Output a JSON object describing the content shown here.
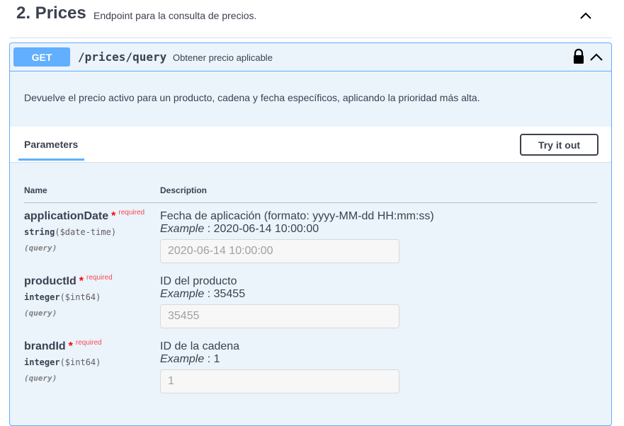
{
  "tag": {
    "title": "2. Prices",
    "description": "Endpoint para la consulta de precios."
  },
  "operation": {
    "method": "GET",
    "path": "/prices/query",
    "summary": "Obtener precio aplicable",
    "description": "Devuelve el precio activo para un producto, cadena y fecha específicos, aplicando la prioridad más alta.",
    "method_color": "#61affe"
  },
  "parameters_section": {
    "tab_label": "Parameters",
    "try_button": "Try it out",
    "col_name": "Name",
    "col_description": "Description"
  },
  "parameters": [
    {
      "name": "applicationDate",
      "required_mark": "*",
      "required_label": "required",
      "type": "string",
      "format": "($date-time)",
      "in": "(query)",
      "description": "Fecha de aplicación (formato: yyyy-MM-dd HH:mm:ss)",
      "example_label": "Example",
      "example_value": ": 2020-06-14 10:00:00",
      "placeholder": "2020-06-14 10:00:00"
    },
    {
      "name": "productId",
      "required_mark": "*",
      "required_label": "required",
      "type": "integer",
      "format": "($int64)",
      "in": "(query)",
      "description": "ID del producto",
      "example_label": "Example",
      "example_value": ": 35455",
      "placeholder": "35455"
    },
    {
      "name": "brandId",
      "required_mark": "*",
      "required_label": "required",
      "type": "integer",
      "format": "($int64)",
      "in": "(query)",
      "description": "ID de la cadena",
      "example_label": "Example",
      "example_value": ": 1",
      "placeholder": "1"
    }
  ],
  "icons": {
    "tag_toggle": "chevron-up-icon",
    "lock": "lock-icon",
    "op_toggle": "chevron-up-icon"
  }
}
